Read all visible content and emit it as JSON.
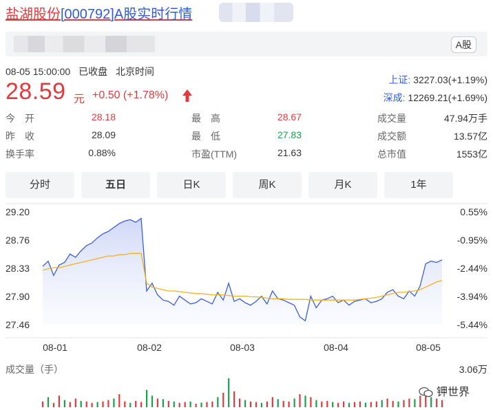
{
  "header": {
    "name": "盐湖股份",
    "code": "[000792]",
    "suffix": "A股实时行情",
    "market_badge": "A股"
  },
  "status": {
    "datetime": "08-05 15:00:00",
    "state": "已收盘",
    "timezone": "北京时间"
  },
  "quote": {
    "price": "28.59",
    "unit": "元",
    "change": "+0.50 (+1.78%)",
    "direction": "up"
  },
  "indices": [
    {
      "label": "上证:",
      "value": "3227.03(+1.19%)"
    },
    {
      "label": "深成:",
      "value": "12269.21(+1.69%)"
    }
  ],
  "stats": [
    {
      "label": "今　开",
      "value": "28.18",
      "color": "#e4393c"
    },
    {
      "label": "最　高",
      "value": "28.67",
      "color": "#e4393c"
    },
    {
      "label": "成交量",
      "value": "47.94万手",
      "color": "#333333"
    },
    {
      "label": "昨　收",
      "value": "28.09",
      "color": "#333333"
    },
    {
      "label": "最　低",
      "value": "27.83",
      "color": "#16a34a"
    },
    {
      "label": "成交额",
      "value": "13.57亿",
      "color": "#333333"
    },
    {
      "label": "换手率",
      "value": "0.88%",
      "color": "#333333"
    },
    {
      "label": "市盈(TTM)",
      "value": "21.63",
      "color": "#333333"
    },
    {
      "label": "总市值",
      "value": "1553亿",
      "color": "#333333"
    }
  ],
  "tabs": [
    {
      "label": "分时",
      "active": false
    },
    {
      "label": "五日",
      "active": true
    },
    {
      "label": "日K",
      "active": false
    },
    {
      "label": "周K",
      "active": false
    },
    {
      "label": "月K",
      "active": false
    },
    {
      "label": "1年",
      "active": false
    }
  ],
  "chart_data": {
    "type": "line",
    "y_left_ticks": [
      "29.20",
      "28.76",
      "28.33",
      "27.90",
      "27.46"
    ],
    "y_right_ticks": [
      "0.55%",
      "-0.95%",
      "-2.44%",
      "-3.94%",
      "-5.44%"
    ],
    "ylim": [
      27.46,
      29.2
    ],
    "x_ticks": [
      "08-01",
      "08-02",
      "08-03",
      "08-04",
      "08-05"
    ],
    "series": [
      {
        "values": [
          28.36,
          28.44,
          28.22,
          28.38,
          28.42,
          28.55,
          28.5,
          28.6,
          28.68,
          28.72,
          28.8,
          28.86,
          28.9,
          28.96,
          29.02,
          29.06,
          29.08,
          29.04,
          29.1,
          27.98,
          28.1,
          27.92,
          27.84,
          27.82,
          27.76,
          27.9,
          27.84,
          27.78,
          27.8,
          27.86,
          27.82,
          27.78,
          27.96,
          27.84,
          28.1,
          27.82,
          27.86,
          27.8,
          27.76,
          27.82,
          27.9,
          27.78,
          27.98,
          27.86,
          27.84,
          27.8,
          27.76,
          27.58,
          27.52,
          27.9,
          27.72,
          27.84,
          27.86,
          27.9,
          27.8,
          27.84,
          27.76,
          27.82,
          27.84,
          27.86,
          27.8,
          27.82,
          27.86,
          27.96,
          28.0,
          27.9,
          27.86,
          27.98,
          27.9,
          28.06,
          28.4,
          28.44,
          28.42,
          28.46
        ],
        "color": "#3a5ed6"
      },
      {
        "values": [
          28.3,
          28.32,
          28.34,
          28.34,
          28.36,
          28.38,
          28.4,
          28.42,
          28.44,
          28.46,
          28.48,
          28.5,
          28.52,
          28.52,
          28.54,
          28.54,
          28.56,
          28.56,
          28.56,
          28.1,
          28.04,
          28.02,
          28.0,
          27.98,
          27.98,
          27.97,
          27.96,
          27.95,
          27.94,
          27.94,
          27.93,
          27.92,
          27.92,
          27.92,
          27.91,
          27.9,
          27.9,
          27.9,
          27.89,
          27.89,
          27.88,
          27.87,
          27.86,
          27.86,
          27.86,
          27.85,
          27.85,
          27.85,
          27.85,
          27.84,
          27.84,
          27.84,
          27.84,
          27.84,
          27.84,
          27.84,
          27.84,
          27.84,
          27.85,
          27.86,
          27.87,
          27.88,
          27.9,
          27.92,
          27.94,
          27.96,
          27.96,
          27.97,
          27.98,
          28.0,
          28.04,
          28.08,
          28.12,
          28.14
        ],
        "color": "#f0b21c"
      }
    ],
    "volume": {
      "label": "成交量（手）",
      "max": "3.06万",
      "values": [
        0.2,
        0.35,
        0.15,
        0.4,
        0.25,
        0.18,
        0.3,
        0.22,
        0.2,
        0.15,
        0.18,
        0.2,
        0.25,
        0.3,
        0.45,
        0.2,
        0.15,
        0.22,
        0.18,
        0.6,
        0.4,
        0.3,
        0.28,
        0.22,
        0.2,
        0.15,
        0.18,
        0.2,
        0.12,
        0.16,
        0.18,
        0.2,
        0.35,
        0.5,
        1.0,
        0.55,
        0.3,
        0.25,
        0.2,
        0.18,
        0.15,
        0.2,
        0.35,
        0.28,
        0.22,
        0.2,
        0.3,
        0.45,
        0.4,
        0.35,
        0.25,
        0.2,
        0.22,
        0.18,
        0.15,
        0.2,
        0.15,
        0.18,
        0.2,
        0.16,
        0.18,
        0.2,
        0.25,
        0.3,
        0.22,
        0.2,
        0.25,
        0.3,
        0.28,
        0.4,
        0.5,
        0.35,
        0.3,
        0.25
      ],
      "up": [
        true,
        false,
        true,
        true,
        false,
        true,
        true,
        false,
        true,
        true,
        false,
        true,
        true,
        false,
        true,
        true,
        false,
        true,
        true,
        false,
        false,
        true,
        false,
        true,
        false,
        true,
        true,
        false,
        true,
        false,
        true,
        true,
        false,
        true,
        false,
        true,
        true,
        false,
        true,
        true,
        false,
        true,
        true,
        false,
        true,
        true,
        false,
        true,
        false,
        true,
        false,
        true,
        true,
        false,
        true,
        true,
        false,
        true,
        true,
        false,
        true,
        true,
        false,
        true,
        true,
        false,
        true,
        true,
        false,
        true,
        true,
        false,
        true,
        true
      ],
      "up_color": "#e4393c",
      "down_color": "#16a34a"
    }
  },
  "watermark": {
    "text": "钾世界"
  }
}
